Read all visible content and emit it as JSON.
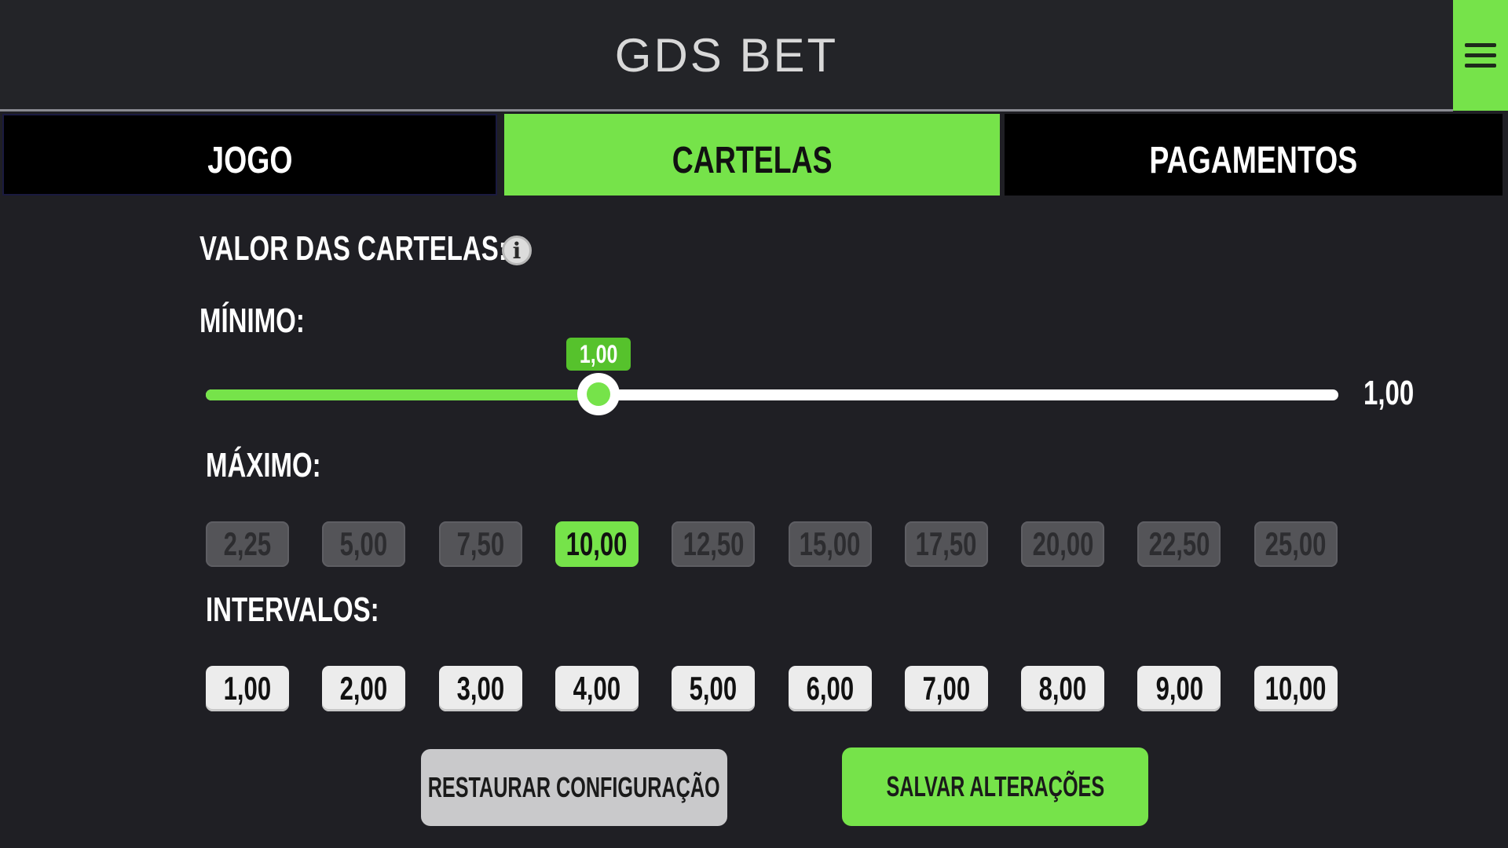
{
  "app": {
    "title": "GDS BET",
    "menu_icon": "hamburger-menu-icon"
  },
  "colors": {
    "accent": "#76e34a",
    "background": "#1f1f24",
    "tab_inactive": "#000000"
  },
  "tabs": [
    {
      "label": "JOGO",
      "active": false
    },
    {
      "label": "CARTELAS",
      "active": true
    },
    {
      "label": "PAGAMENTOS",
      "active": false
    }
  ],
  "cartelas": {
    "section_title": "VALOR DAS CARTELAS:",
    "info_icon": "info-icon",
    "minimo": {
      "label": "MÍNIMO:",
      "tooltip": "1,00",
      "value_display": "1,00",
      "slider_fraction": 0.347
    },
    "maximo": {
      "label": "MÁXIMO:",
      "options": [
        "2,25",
        "5,00",
        "7,50",
        "10,00",
        "12,50",
        "15,00",
        "17,50",
        "20,00",
        "22,50",
        "25,00"
      ],
      "selected": "10,00"
    },
    "intervalos": {
      "label": "INTERVALOS:",
      "options": [
        "1,00",
        "2,00",
        "3,00",
        "4,00",
        "5,00",
        "6,00",
        "7,00",
        "8,00",
        "9,00",
        "10,00"
      ]
    }
  },
  "actions": {
    "restore_label": "RESTAURAR CONFIGURAÇÃO",
    "save_label": "SALVAR ALTERAÇÕES"
  }
}
